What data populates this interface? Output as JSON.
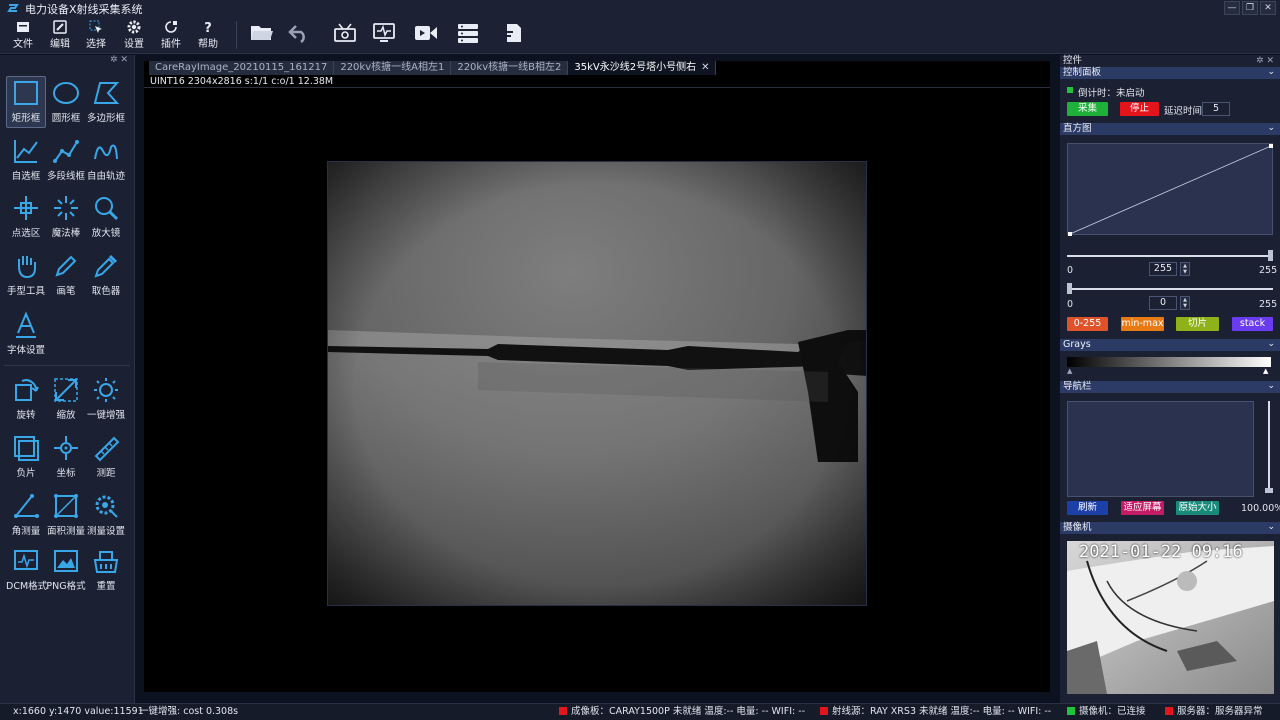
{
  "window": {
    "title": "电力设备X射线采集系统",
    "min": "—",
    "restore": "❐",
    "close": "✕"
  },
  "menu": [
    {
      "label": "文件",
      "icon": "file-icon"
    },
    {
      "label": "编辑",
      "icon": "edit-icon"
    },
    {
      "label": "选择",
      "icon": "select-icon"
    },
    {
      "label": "设置",
      "icon": "gear-icon"
    },
    {
      "label": "插件",
      "icon": "plugin-icon"
    },
    {
      "label": "帮助",
      "icon": "help-icon"
    }
  ],
  "left_tools": [
    {
      "label": "矩形框"
    },
    {
      "label": "圆形框"
    },
    {
      "label": "多边形框"
    },
    {
      "label": "自选框"
    },
    {
      "label": "多段线框"
    },
    {
      "label": "自由轨迹"
    },
    {
      "label": "点选区"
    },
    {
      "label": "魔法棒"
    },
    {
      "label": "放大镜"
    },
    {
      "label": "手型工具"
    },
    {
      "label": "画笔"
    },
    {
      "label": "取色器"
    },
    {
      "label": "字体设置"
    },
    {
      "label": "旋转"
    },
    {
      "label": "缩放"
    },
    {
      "label": "一键增强"
    },
    {
      "label": "负片"
    },
    {
      "label": "坐标"
    },
    {
      "label": "测距"
    },
    {
      "label": "角测量"
    },
    {
      "label": "面积测量"
    },
    {
      "label": "测量设置"
    },
    {
      "label": "DCM格式"
    },
    {
      "label": "PNG格式"
    },
    {
      "label": "重置"
    }
  ],
  "left_panel_pin": "✲ ✕",
  "tabs": [
    {
      "label": "CareRayImage_20210115_161217"
    },
    {
      "label": "220kv核搪一线A相左1"
    },
    {
      "label": "220kv核搪一线B相左2"
    },
    {
      "label": "35kV永沙线2号塔小号侧右",
      "close": "✕"
    }
  ],
  "image_info": "UINT16 2304x2816 s:1/1 c:o/1 12.38M",
  "right": {
    "panel_title": "控件",
    "pin": "✲ ✕",
    "control": {
      "title": "控制面板",
      "countdown": "倒计时：未启动",
      "collect": "采集",
      "stop": "停止",
      "delay_label": "延迟时间",
      "delay_value": "5"
    },
    "histogram": {
      "title": "直方图",
      "min": "0",
      "max": "255",
      "upper_value": "255",
      "upper_max": "255",
      "lower_value": "0",
      "lower_min": "0",
      "lower_max": "255",
      "btn_0_255": "0-255",
      "btn_minmax": "min-max",
      "btn_slice": "切片",
      "btn_stack": "stack"
    },
    "grays": {
      "title": "Grays"
    },
    "nav": {
      "title": "导航栏",
      "refresh": "刷新",
      "fit": "适应屏幕",
      "original": "原始大小",
      "zoom": "100.00%"
    },
    "camera": {
      "title": "摄像机",
      "timestamp": "2021-01-22 09:16"
    }
  },
  "status": {
    "coords": "x:1660 y:1470  value:11591",
    "enhance": "一键增强: cost 0.308s",
    "detector": "成像板：CARAY1500P 未就绪  温度:--  电量: --   WIFI: --",
    "source": "射线源：RAY XRS3 未就绪  温度:--  电量: --   WIFI: --",
    "camera": "摄像机：已连接",
    "server": "服务器：服务器异常"
  },
  "colors": {
    "collect": "#1fb03a",
    "stop": "#e3141b",
    "btn_0_255": "#e0532a",
    "btn_minmax": "#e87a14",
    "btn_slice": "#8fb21a",
    "btn_stack": "#6a3cf0",
    "refresh": "#1c3fa8",
    "fit": "#c21d64",
    "original": "#1a8a7a",
    "accent_icon": "#39a6e8",
    "status_red": "#e3141b",
    "status_green": "#1fc43a"
  }
}
